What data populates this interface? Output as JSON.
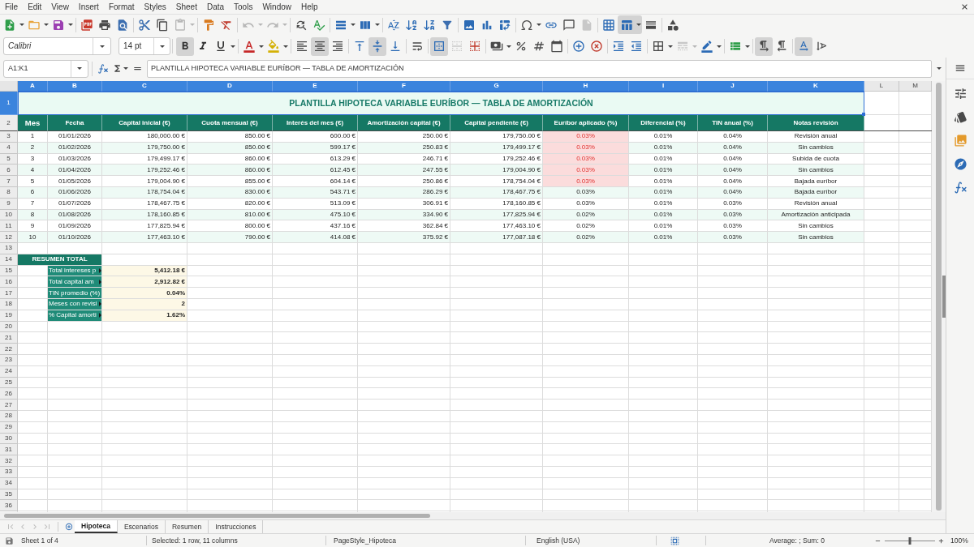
{
  "menu": [
    "File",
    "Edit",
    "View",
    "Insert",
    "Format",
    "Styles",
    "Sheet",
    "Data",
    "Tools",
    "Window",
    "Help"
  ],
  "standard_toolbar": [
    {
      "kind": "new",
      "active": false,
      "disabled": false
    },
    {
      "kind": "open",
      "active": false,
      "disabled": false
    },
    {
      "kind": "save",
      "active": false,
      "disabled": false
    },
    {
      "kind": "pdf",
      "active": false,
      "disabled": false
    },
    {
      "kind": "print",
      "active": false,
      "disabled": false
    },
    {
      "kind": "preview",
      "active": false,
      "disabled": false
    },
    {
      "kind": "cut",
      "active": false,
      "disabled": false
    },
    {
      "kind": "copy",
      "active": false,
      "disabled": false
    },
    {
      "kind": "paste",
      "active": false,
      "disabled": true
    },
    {
      "kind": "clone",
      "active": false,
      "disabled": false
    },
    {
      "kind": "clear",
      "active": false,
      "disabled": false
    },
    {
      "kind": "undo",
      "active": false,
      "disabled": true
    },
    {
      "kind": "redo",
      "active": false,
      "disabled": true
    },
    {
      "kind": "find",
      "active": false,
      "disabled": false
    },
    {
      "kind": "spelling",
      "active": false,
      "disabled": false
    },
    {
      "kind": "rows",
      "active": false,
      "disabled": false
    },
    {
      "kind": "columns",
      "active": false,
      "disabled": false
    },
    {
      "kind": "sort",
      "active": false,
      "disabled": false
    },
    {
      "kind": "ascending",
      "active": false,
      "disabled": false
    },
    {
      "kind": "descending",
      "active": false,
      "disabled": false
    },
    {
      "kind": "filter",
      "active": false,
      "disabled": false
    },
    {
      "kind": "image",
      "active": false,
      "disabled": false
    },
    {
      "kind": "chart",
      "active": false,
      "disabled": false
    },
    {
      "kind": "pivot",
      "active": false,
      "disabled": false
    },
    {
      "kind": "symbol",
      "active": false,
      "disabled": false
    },
    {
      "kind": "link",
      "active": false,
      "disabled": false
    },
    {
      "kind": "comment",
      "active": false,
      "disabled": false
    },
    {
      "kind": "headers",
      "active": false,
      "disabled": true
    },
    {
      "kind": "printarea",
      "active": false,
      "disabled": false
    },
    {
      "kind": "freeze",
      "active": true,
      "disabled": false
    },
    {
      "kind": "split",
      "active": false,
      "disabled": false
    },
    {
      "kind": "shapes",
      "active": false,
      "disabled": false
    }
  ],
  "formatting_toolbar": {
    "font_name": "Calibri",
    "font_size": "14 pt",
    "buttons": [
      {
        "kind": "bold",
        "active": true,
        "disabled": false
      },
      {
        "kind": "italic",
        "active": false,
        "disabled": false
      },
      {
        "kind": "underline",
        "active": false,
        "disabled": false
      },
      {
        "kind": "fontcolor",
        "active": false,
        "disabled": false
      },
      {
        "kind": "highlight",
        "active": false,
        "disabled": false
      },
      {
        "kind": "left",
        "active": false,
        "disabled": false
      },
      {
        "kind": "center",
        "active": true,
        "disabled": false
      },
      {
        "kind": "right",
        "active": false,
        "disabled": false
      },
      {
        "kind": "top",
        "active": false,
        "disabled": false
      },
      {
        "kind": "middle",
        "active": true,
        "disabled": false
      },
      {
        "kind": "bottom",
        "active": false,
        "disabled": false
      },
      {
        "kind": "wrap",
        "active": false,
        "disabled": false
      },
      {
        "kind": "mergecenter",
        "active": true,
        "disabled": false
      },
      {
        "kind": "merge",
        "active": false,
        "disabled": true
      },
      {
        "kind": "unmerge",
        "active": false,
        "disabled": false
      },
      {
        "kind": "currency",
        "active": false,
        "disabled": false
      },
      {
        "kind": "percent",
        "active": false,
        "disabled": false
      },
      {
        "kind": "number",
        "active": false,
        "disabled": false
      },
      {
        "kind": "date",
        "active": false,
        "disabled": false
      },
      {
        "kind": "adddecimal",
        "active": false,
        "disabled": false
      },
      {
        "kind": "deldecimal",
        "active": false,
        "disabled": false
      },
      {
        "kind": "indent",
        "active": false,
        "disabled": false
      },
      {
        "kind": "outdent",
        "active": false,
        "disabled": false
      },
      {
        "kind": "borders",
        "active": false,
        "disabled": false
      },
      {
        "kind": "borderstyle",
        "active": false,
        "disabled": true
      },
      {
        "kind": "bordercolor",
        "active": false,
        "disabled": false
      },
      {
        "kind": "conditional",
        "active": false,
        "disabled": false
      },
      {
        "kind": "ltr",
        "active": true,
        "disabled": false
      },
      {
        "kind": "rtl",
        "active": false,
        "disabled": false
      },
      {
        "kind": "textdir",
        "active": true,
        "disabled": false
      },
      {
        "kind": "vertical",
        "active": false,
        "disabled": false
      }
    ]
  },
  "formula_bar": {
    "name_box": "A1:K1",
    "content": "PLANTILLA HIPOTECA VARIABLE EURÍBOR — TABLA DE AMORTIZACIÓN"
  },
  "sheet": {
    "columns": [
      {
        "label": "A",
        "selected": true
      },
      {
        "label": "B",
        "selected": true
      },
      {
        "label": "C",
        "selected": true
      },
      {
        "label": "D",
        "selected": true
      },
      {
        "label": "E",
        "selected": true
      },
      {
        "label": "F",
        "selected": true
      },
      {
        "label": "G",
        "selected": true
      },
      {
        "label": "H",
        "selected": true
      },
      {
        "label": "I",
        "selected": true
      },
      {
        "label": "J",
        "selected": true
      },
      {
        "label": "K",
        "selected": true
      },
      {
        "label": "L",
        "selected": false
      },
      {
        "label": "M",
        "selected": false
      }
    ],
    "rows": [
      {
        "label": "1",
        "selected": true
      },
      {
        "label": "2",
        "selected": false
      },
      {
        "label": "3",
        "selected": false
      },
      {
        "label": "4",
        "selected": false
      },
      {
        "label": "5",
        "selected": false
      },
      {
        "label": "6",
        "selected": false
      },
      {
        "label": "7",
        "selected": false
      },
      {
        "label": "8",
        "selected": false
      },
      {
        "label": "9",
        "selected": false
      },
      {
        "label": "10",
        "selected": false
      },
      {
        "label": "11",
        "selected": false
      },
      {
        "label": "12",
        "selected": false
      },
      {
        "label": "13",
        "selected": false
      },
      {
        "label": "14",
        "selected": false
      },
      {
        "label": "15",
        "selected": false
      },
      {
        "label": "16",
        "selected": false
      },
      {
        "label": "17",
        "selected": false
      },
      {
        "label": "18",
        "selected": false
      },
      {
        "label": "19",
        "selected": false
      },
      {
        "label": "20",
        "selected": false
      },
      {
        "label": "21",
        "selected": false
      },
      {
        "label": "22",
        "selected": false
      },
      {
        "label": "23",
        "selected": false
      },
      {
        "label": "24",
        "selected": false
      },
      {
        "label": "25",
        "selected": false
      },
      {
        "label": "26",
        "selected": false
      },
      {
        "label": "27",
        "selected": false
      },
      {
        "label": "28",
        "selected": false
      },
      {
        "label": "29",
        "selected": false
      },
      {
        "label": "30",
        "selected": false
      },
      {
        "label": "31",
        "selected": false
      },
      {
        "label": "32",
        "selected": false
      },
      {
        "label": "33",
        "selected": false
      },
      {
        "label": "34",
        "selected": false
      },
      {
        "label": "35",
        "selected": false
      },
      {
        "label": "36",
        "selected": false
      }
    ],
    "title": {
      "text": "PLANTILLA HIPOTECA VARIABLE EURÍBOR — TABLA DE AMORTIZACIÓN",
      "selected": true
    },
    "table": {
      "header": [
        "Mes",
        "Fecha",
        "Capital inicial (€)",
        "Cuota mensual (€)",
        "Interés del mes (€)",
        "Amortización capital (€)",
        "Capital pendiente (€)",
        "Euríbor aplicado (%)",
        "Diferencial (%)",
        "TIN anual (%)",
        "Notas revisión"
      ],
      "rows": [
        {
          "cells": [
            "1",
            "01/01/2026",
            "180,000.00 €",
            "850.00 €",
            "600.00 €",
            "250.00 €",
            "179,750.00 €",
            "0.03%",
            "0.01%",
            "0.04%",
            "Revisión anual"
          ],
          "highlighted": true
        },
        {
          "cells": [
            "2",
            "01/02/2026",
            "179,750.00 €",
            "850.00 €",
            "599.17 €",
            "250.83 €",
            "179,499.17 €",
            "0.03%",
            "0.01%",
            "0.04%",
            "Sin cambios"
          ],
          "highlighted": true
        },
        {
          "cells": [
            "3",
            "01/03/2026",
            "179,499.17 €",
            "860.00 €",
            "613.29 €",
            "246.71 €",
            "179,252.46 €",
            "0.03%",
            "0.01%",
            "0.04%",
            "Subida de cuota"
          ],
          "highlighted": true
        },
        {
          "cells": [
            "4",
            "01/04/2026",
            "179,252.46 €",
            "860.00 €",
            "612.45 €",
            "247.55 €",
            "179,004.90 €",
            "0.03%",
            "0.01%",
            "0.04%",
            "Sin cambios"
          ],
          "highlighted": true
        },
        {
          "cells": [
            "5",
            "01/05/2026",
            "179,004.90 €",
            "855.00 €",
            "604.14 €",
            "250.86 €",
            "178,754.04 €",
            "0.03%",
            "0.01%",
            "0.04%",
            "Bajada euríbor"
          ],
          "highlighted": true
        },
        {
          "cells": [
            "6",
            "01/06/2026",
            "178,754.04 €",
            "830.00 €",
            "543.71 €",
            "286.29 €",
            "178,467.75 €",
            "0.03%",
            "0.01%",
            "0.04%",
            "Bajada euríbor"
          ],
          "highlighted": false
        },
        {
          "cells": [
            "7",
            "01/07/2026",
            "178,467.75 €",
            "820.00 €",
            "513.09 €",
            "306.91 €",
            "178,160.85 €",
            "0.03%",
            "0.01%",
            "0.03%",
            "Revisión anual"
          ],
          "highlighted": false
        },
        {
          "cells": [
            "8",
            "01/08/2026",
            "178,160.85 €",
            "810.00 €",
            "475.10 €",
            "334.90 €",
            "177,825.94 €",
            "0.02%",
            "0.01%",
            "0.03%",
            "Amortización anticipada"
          ],
          "highlighted": false
        },
        {
          "cells": [
            "9",
            "01/09/2026",
            "177,825.94 €",
            "800.00 €",
            "437.16 €",
            "362.84 €",
            "177,463.10 €",
            "0.02%",
            "0.01%",
            "0.03%",
            "Sin cambios"
          ],
          "highlighted": false
        },
        {
          "cells": [
            "10",
            "01/10/2026",
            "177,463.10 €",
            "790.00 €",
            "414.08 €",
            "375.92 €",
            "177,087.18 €",
            "0.02%",
            "0.01%",
            "0.03%",
            "Sin cambios"
          ],
          "highlighted": false
        }
      ]
    },
    "summary": {
      "title": "RESUMEN TOTAL",
      "items": [
        {
          "label": "Total intereses p",
          "value": "5,412.18 €",
          "overflow": true
        },
        {
          "label": "Total capital am",
          "value": "2,912.82 €",
          "overflow": true
        },
        {
          "label": "TIN promedio (%)",
          "value": "0.04%",
          "overflow": false
        },
        {
          "label": "Meses con revisi",
          "value": "2",
          "overflow": true
        },
        {
          "label": "% Capital amorti",
          "value": "1.62%",
          "overflow": true
        }
      ]
    }
  },
  "sheet_nav": [
    {
      "kind": "first",
      "disabled": true
    },
    {
      "kind": "previous",
      "disabled": true
    },
    {
      "kind": "next",
      "disabled": true
    },
    {
      "kind": "last",
      "disabled": true
    }
  ],
  "sheet_tabs": [
    {
      "label": "Hipoteca",
      "selected": true
    },
    {
      "label": "Escenarios",
      "selected": false
    },
    {
      "label": "Resumen",
      "selected": false
    },
    {
      "label": "Instrucciones",
      "selected": false
    }
  ],
  "status_bar": {
    "sheet_info": "Sheet 1 of 4",
    "selection": "Selected: 1 row, 11 columns",
    "page_style": "PageStyle_Hipoteca",
    "language": "English (USA)",
    "aggregate": "Average: ; Sum: 0",
    "zoom": {
      "level": 0.5,
      "reading": "100%"
    }
  }
}
